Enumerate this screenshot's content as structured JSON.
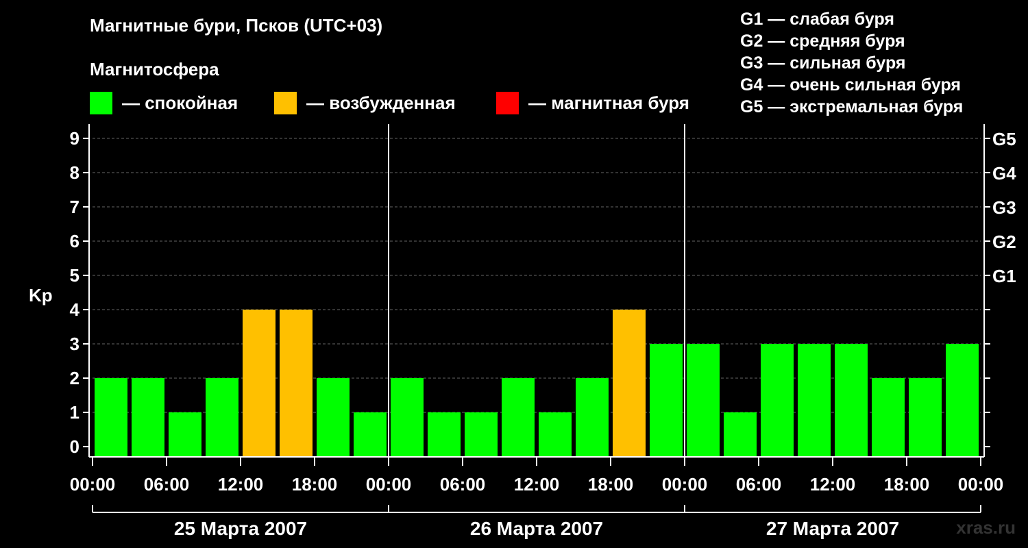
{
  "title": "Магнитные бури, Псков (UTC+03)",
  "legend": {
    "title": "Магнитосфера",
    "items": [
      {
        "label": "— спокойная",
        "color": "#00ff00"
      },
      {
        "label": "— возбужденная",
        "color": "#ffc000"
      },
      {
        "label": "— магнитная буря",
        "color": "#ff0000"
      }
    ]
  },
  "storm_levels": [
    "G1 — слабая буря",
    "G2 — средняя буря",
    "G3 — сильная буря",
    "G4 — очень сильная буря",
    "G5 — экстремальная буря"
  ],
  "watermark": "xras.ru",
  "chart_data": {
    "type": "bar",
    "ylabel": "Kp",
    "ylim": [
      0,
      9
    ],
    "yticks": [
      "0",
      "1",
      "2",
      "3",
      "4",
      "5",
      "6",
      "7",
      "8",
      "9"
    ],
    "right_ticks": [
      {
        "kp": 5,
        "label": "G1"
      },
      {
        "kp": 6,
        "label": "G2"
      },
      {
        "kp": 7,
        "label": "G3"
      },
      {
        "kp": 8,
        "label": "G4"
      },
      {
        "kp": 9,
        "label": "G5"
      }
    ],
    "grid": true,
    "xtick_labels": [
      "00:00",
      "06:00",
      "12:00",
      "18:00",
      "00:00",
      "06:00",
      "12:00",
      "18:00",
      "00:00",
      "06:00",
      "12:00",
      "18:00",
      "00:00"
    ],
    "days": [
      "25 Марта 2007",
      "26 Марта 2007",
      "27 Марта 2007"
    ],
    "interval_hours": 3,
    "series": [
      {
        "values": [
          2,
          2,
          1,
          2,
          4,
          4,
          2,
          1,
          2,
          1,
          1,
          2,
          1,
          2,
          4,
          3,
          3,
          1,
          3,
          3,
          3,
          2,
          2,
          3
        ]
      }
    ],
    "color_rule": {
      "quiet_max": 3,
      "quiet": "#00ff00",
      "active": "#ffc000",
      "storm_min": 5,
      "storm": "#ff0000"
    }
  }
}
